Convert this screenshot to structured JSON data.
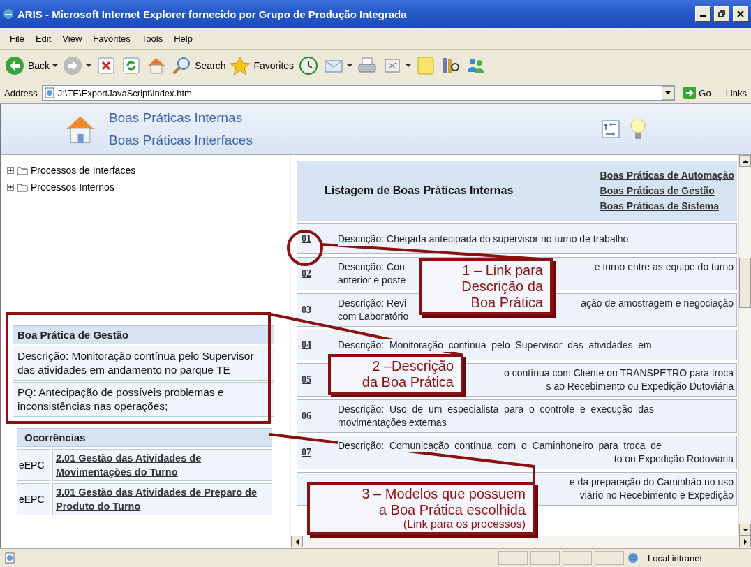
{
  "window": {
    "title": "ARIS - Microsoft Internet Explorer fornecido por Grupo de Produção Integrada"
  },
  "menu": [
    "File",
    "Edit",
    "View",
    "Favorites",
    "Tools",
    "Help"
  ],
  "toolbar": [
    {
      "kind": "back",
      "label": "Back",
      "dropdown": true
    },
    {
      "kind": "forward",
      "dropdown": true
    },
    {
      "kind": "stop",
      "dropdown": false
    },
    {
      "kind": "refresh",
      "dropdown": false
    },
    {
      "kind": "home",
      "dropdown": false
    },
    {
      "kind": "search",
      "label": "Search",
      "dropdown": false
    },
    {
      "kind": "favorites",
      "label": "Favorites",
      "dropdown": false
    },
    {
      "kind": "history",
      "dropdown": false
    },
    {
      "kind": "mail",
      "dropdown": true
    },
    {
      "kind": "print",
      "dropdown": false
    },
    {
      "kind": "edit",
      "dropdown": true
    },
    {
      "kind": "note",
      "dropdown": false
    },
    {
      "kind": "research",
      "dropdown": false
    },
    {
      "kind": "messenger",
      "dropdown": false
    }
  ],
  "address": {
    "label": "Address",
    "value": "J:\\TE\\ExportJavaScript\\index.htm",
    "go": "Go",
    "links": "Links"
  },
  "header": {
    "links": [
      "Boas Práticas Internas",
      "Boas Práticas Interfaces"
    ]
  },
  "tree": [
    {
      "label": "Processos de Interfaces",
      "expanded": false
    },
    {
      "label": "Processos Internos",
      "expanded": false
    }
  ],
  "detail": {
    "title": "Boa Prática de Gestão",
    "description": "Descrição: Monitoração contínua pelo Supervisor das atividades em andamento no parque TE",
    "pq": "PQ: Antecipação de possíveis problemas e inconsistências nas operações;"
  },
  "occurrences": {
    "title": "Ocorrências",
    "items": [
      {
        "type": "eEPC",
        "label": "2.01  Gestão das Atividades de Movimentações do Turno"
      },
      {
        "type": "eEPC",
        "label": "3.01  Gestão das Atividades de Preparo de Produto do Turno"
      }
    ]
  },
  "listing": {
    "title": "Listagem de Boas Práticas Internas",
    "links": [
      "Boas Práticas de Automação",
      "Boas Práticas de Gestão",
      "Boas Práticas de Sistema"
    ],
    "rows": [
      {
        "number": "01",
        "lines": [
          {
            "left": "Descrição: Chegada antecipada do supervisor no turno de trabalho"
          }
        ]
      },
      {
        "number": "02",
        "lines": [
          {
            "left": "Descrição: Con",
            "right": "e turno entre as equipe do turno"
          },
          {
            "left": "anterior e poste"
          }
        ]
      },
      {
        "number": "03",
        "lines": [
          {
            "left": "Descrição: Revi",
            "right": "ação de amostragem e negociação"
          },
          {
            "left": "com Laboratório"
          }
        ]
      },
      {
        "number": "04",
        "lines": [
          {
            "left": "Descrição:  Monitoração  contínua  pelo  Supervisor  das  atividades  em"
          }
        ]
      },
      {
        "number": "05",
        "lines": [
          {
            "right": "o contínua com Cliente ou TRANSPETRO para troca"
          },
          {
            "right": "s ao Recebimento ou Expedição Dutoviária"
          }
        ]
      },
      {
        "number": "06",
        "lines": [
          {
            "left": "Descrição:  Uso  de  um  especialista  para  o  controle  e  execução  das"
          },
          {
            "left": "movimentações externas"
          }
        ]
      },
      {
        "number": "07",
        "lines": [
          {
            "left": "Descrição:  Comunicação  contínua  com  o  Caminhoneiro  para  troca  de"
          },
          {
            "right": "to ou Expedição Rodoviária"
          }
        ]
      },
      {
        "lines": [
          {
            "right": "e da preparação do Caminhão no uso"
          },
          {
            "right": "viário no Recebimento e Expedição"
          }
        ]
      }
    ]
  },
  "callouts": [
    {
      "text": "1 – Link para\nDescrição da\nBoa Prática"
    },
    {
      "text": "2 –Descrição\nda Boa Prática"
    },
    {
      "text": "3 – Modelos que possuem\na  Boa Prática escolhida",
      "note": "(Link para os processos)"
    }
  ],
  "status_bar": {
    "zone": "Local intranet"
  }
}
